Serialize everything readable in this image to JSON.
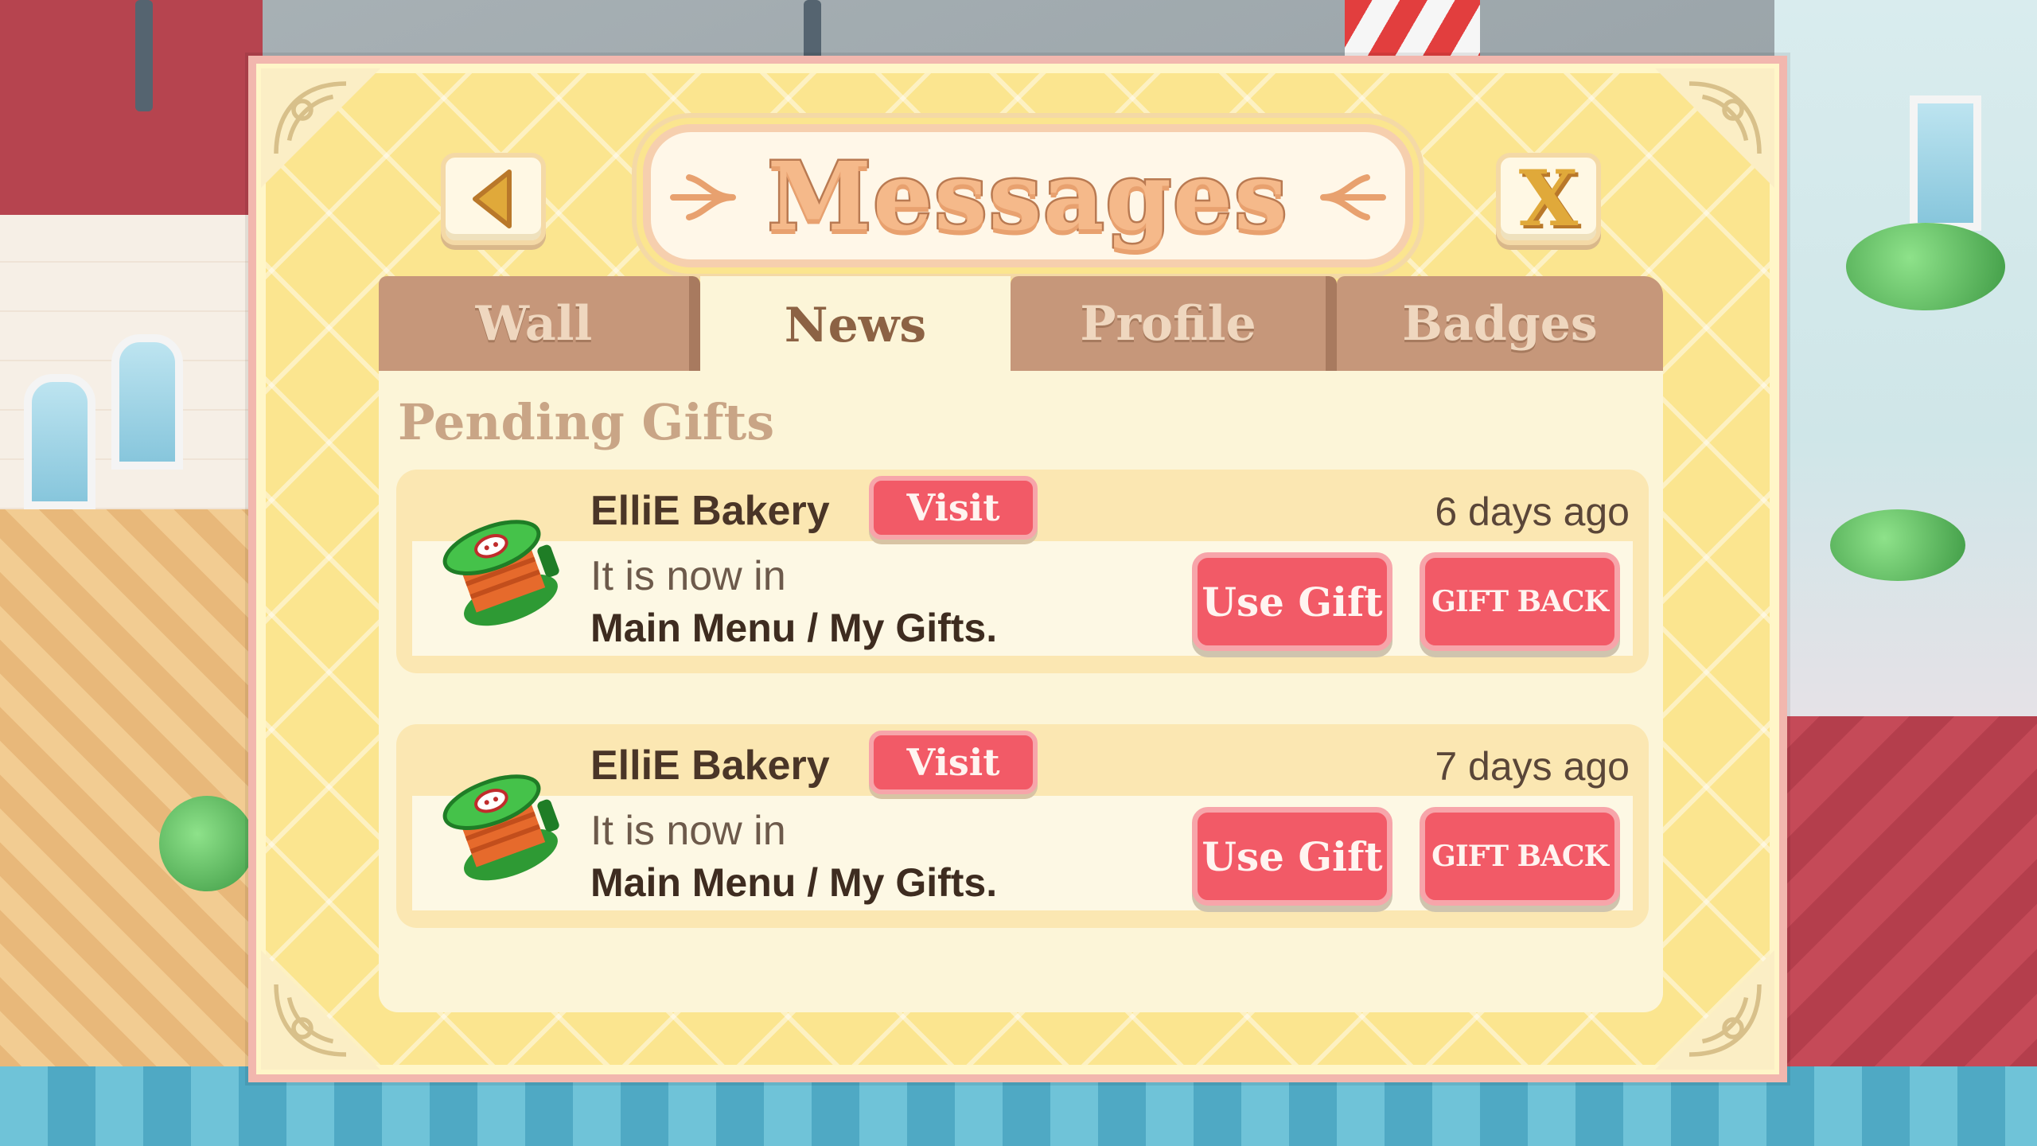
{
  "dialog": {
    "title": "Messages",
    "back_icon": "back-arrow-icon",
    "close_label": "X"
  },
  "tabs": [
    {
      "label": "Wall",
      "active": false
    },
    {
      "label": "News",
      "active": true
    },
    {
      "label": "Profile",
      "active": false
    },
    {
      "label": "Badges",
      "active": false
    }
  ],
  "section": {
    "title": "Pending Gifts"
  },
  "gifts": [
    {
      "sender": "ElliE Bakery",
      "visit_label": "Visit",
      "time": "6 days ago",
      "line1": "It is now in",
      "line2": "Main Menu / My Gifts.",
      "use_label": "Use Gift",
      "back_label": "GIFT BACK",
      "icon": "cable-spool-gift-icon"
    },
    {
      "sender": "ElliE Bakery",
      "visit_label": "Visit",
      "time": "7 days ago",
      "line1": "It is now in",
      "line2": "Main Menu / My Gifts.",
      "use_label": "Use Gift",
      "back_label": "GIFT BACK",
      "icon": "cable-spool-gift-icon"
    }
  ],
  "colors": {
    "frame": "#fbe58f",
    "tab_inactive": "#c6977a",
    "panel": "#fcf5d8",
    "button_red": "#f25a67",
    "title_fill": "#f5b98a"
  }
}
